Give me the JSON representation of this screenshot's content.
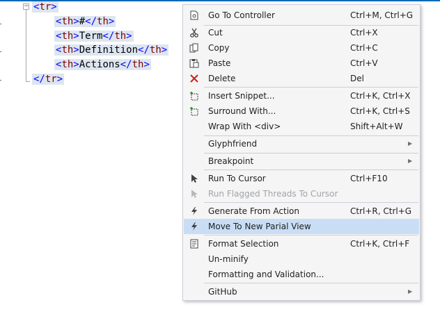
{
  "editor": {
    "lines": [
      {
        "open": "<",
        "tag": "tr",
        "close": ">"
      },
      {
        "p1": "<",
        "t1": "th",
        "p2": ">",
        "text": "#",
        "p3": "</",
        "t2": "th",
        "p4": ">"
      },
      {
        "p1": "<",
        "t1": "th",
        "p2": ">",
        "text": "Term",
        "p3": "</",
        "t2": "th",
        "p4": ">"
      },
      {
        "p1": "<",
        "t1": "th",
        "p2": ">",
        "text": "Definition",
        "p3": "</",
        "t2": "th",
        "p4": ">"
      },
      {
        "p1": "<",
        "t1": "th",
        "p2": ">",
        "text": "Actions",
        "p3": "</",
        "t2": "th",
        "p4": ">"
      },
      {
        "open": "</",
        "tag": "tr",
        "close": ">"
      }
    ],
    "fold_symbol": "−"
  },
  "context_menu": {
    "items": [
      {
        "label": "Go To Controller",
        "shortcut": "Ctrl+M, Ctrl+G",
        "icon": "document-icon"
      },
      {
        "label": "Cut",
        "shortcut": "Ctrl+X",
        "icon": "scissors-icon"
      },
      {
        "label": "Copy",
        "shortcut": "Ctrl+C",
        "icon": "copy-icon"
      },
      {
        "label": "Paste",
        "shortcut": "Ctrl+V",
        "icon": "paste-icon"
      },
      {
        "label": "Delete",
        "shortcut": "Del",
        "icon": "delete-x-icon"
      },
      {
        "label": "Insert Snippet...",
        "shortcut": "Ctrl+K, Ctrl+X",
        "icon": "snippet-icon"
      },
      {
        "label": "Surround With...",
        "shortcut": "Ctrl+K, Ctrl+S",
        "icon": "surround-icon"
      },
      {
        "label": "Wrap With <div>",
        "shortcut": "Shift+Alt+W",
        "icon": ""
      },
      {
        "label": "Glyphfriend",
        "shortcut": "",
        "icon": ""
      },
      {
        "label": "Breakpoint",
        "shortcut": "",
        "icon": ""
      },
      {
        "label": "Run To Cursor",
        "shortcut": "Ctrl+F10",
        "icon": "cursor-arrow-icon"
      },
      {
        "label": "Run Flagged Threads To Cursor",
        "shortcut": "",
        "icon": "cursor-arrow-icon",
        "disabled": true
      },
      {
        "label": "Generate From Action",
        "shortcut": "Ctrl+R, Ctrl+G",
        "icon": "lightning-icon"
      },
      {
        "label": "Move To New Parial View",
        "shortcut": "",
        "icon": "lightning-icon",
        "highlighted": true
      },
      {
        "label": "Format Selection",
        "shortcut": "Ctrl+K, Ctrl+F",
        "icon": "format-icon"
      },
      {
        "label": "Un-minify",
        "shortcut": "",
        "icon": ""
      },
      {
        "label": "Formatting and Validation...",
        "shortcut": "",
        "icon": ""
      },
      {
        "label": "GitHub",
        "shortcut": "",
        "icon": ""
      }
    ],
    "submenu_arrow": "▶"
  },
  "colors": {
    "accent": "#0a6ab6",
    "highlight": "#c9def5",
    "delete_red": "#c42b1c",
    "snippet_green": "#2f8f2f"
  }
}
